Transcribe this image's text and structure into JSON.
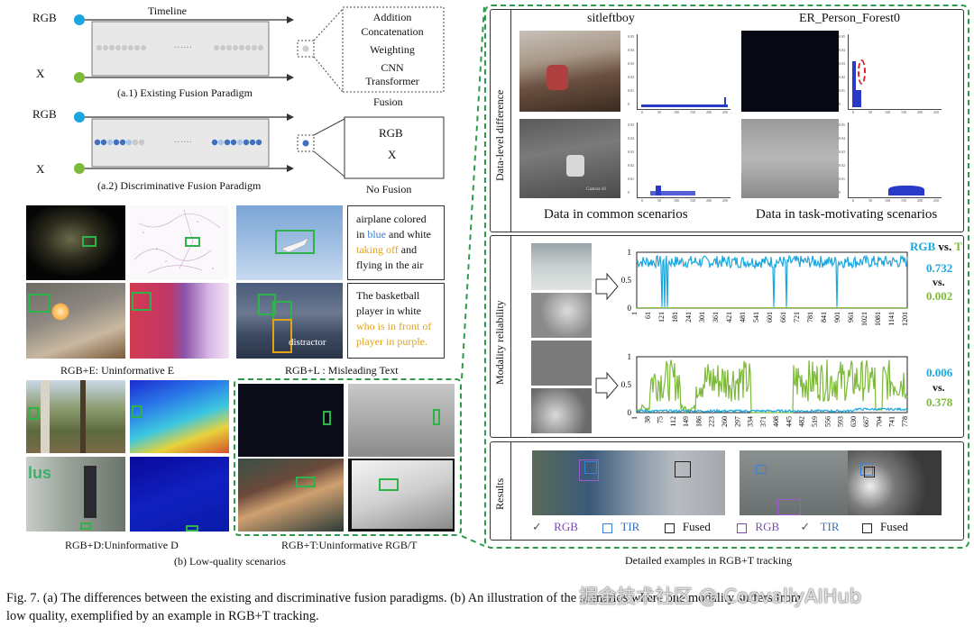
{
  "fig_a": {
    "rgb1": "RGB",
    "x1": "X",
    "timeline": "Timeline",
    "caption1": "(a.1) Existing Fusion Paradigm",
    "methods": [
      "Addition",
      "Concatenation",
      "Weighting",
      "CNN",
      "Transformer"
    ],
    "fusion_label": "Fusion",
    "rgb2": "RGB",
    "x2": "X",
    "caption2": "(a.2) Discriminative Fusion Paradigm",
    "nofusion_rgb": "RGB",
    "nofusion_x": "X",
    "nofusion_label": "No Fusion"
  },
  "fig_b": {
    "text1": [
      "airplane colored",
      "in ",
      "blue",
      " and white",
      "taking off",
      " and",
      "flying in the air"
    ],
    "text2": [
      "The basketball",
      "player in white",
      "who is in front of",
      "player in purple."
    ],
    "distractor": "distractor",
    "label_e": "RGB+E: Uninformative E",
    "label_l": "RGB+L : Misleading Text",
    "label_d": "RGB+D:Uninformative D",
    "label_t": "RGB+T:Uninformative RGB/T",
    "caption": "(b) Low-quality scenarios"
  },
  "fig_right": {
    "panel1_label": "Data-level difference",
    "seq1": "sitleftboy",
    "seq2": "ER_Person_Forest0",
    "common": "Data in common scenarios",
    "task": "Data in task-motivating scenarios",
    "panel2_label": "Modality reliability",
    "rgb_vs": "RGB",
    "vs": "vs.",
    "t_vs": "T",
    "score1_rgb": "0.732",
    "score1_t": "0.002",
    "score2_rgb": "0.006",
    "score2_t": "0.378",
    "chart1_y": [
      "1",
      "0.5",
      "0"
    ],
    "chart1_x": [
      "1",
      "61",
      "121",
      "181",
      "241",
      "301",
      "361",
      "421",
      "481",
      "541",
      "601",
      "661",
      "721",
      "781",
      "841",
      "901",
      "961",
      "1021",
      "1081",
      "1141",
      "1201"
    ],
    "chart2_y": [
      "1",
      "0.5",
      "0"
    ],
    "chart2_x": [
      "1",
      "38",
      "75",
      "112",
      "149",
      "186",
      "223",
      "260",
      "297",
      "334",
      "371",
      "408",
      "445",
      "482",
      "519",
      "556",
      "593",
      "630",
      "667",
      "704",
      "741",
      "778"
    ],
    "panel3_label": "Results",
    "legend": [
      "✓",
      "RGB",
      "TIR",
      "Fused",
      "RGB",
      "✓",
      "TIR",
      "Fused"
    ],
    "caption": "Detailed examples in RGB+T tracking"
  },
  "hist_axis": {
    "ticks": [
      "0",
      "50",
      "100",
      "150",
      "200",
      "250"
    ],
    "yticks": [
      "0.05",
      "0.04",
      "0.03",
      "0.02",
      "0.01",
      "0"
    ]
  },
  "photo_text": {
    "camera_tag": "Camera 10"
  },
  "figure_caption": {
    "line1": "Fig. 7.   (a) The differences between the existing and discriminative fusion paradigms. (b) An illustration of the scenarios where one modality suffers from",
    "line2": "low quality, exemplified by an example in RGB+T tracking."
  },
  "watermark": "掘金技术社区 @ CoovallyAIHub",
  "colors": {
    "rgb": "#1aa7e0",
    "t": "#7dba3a",
    "green_box": "#2db34a",
    "dash_green": "#2e9a4c"
  }
}
